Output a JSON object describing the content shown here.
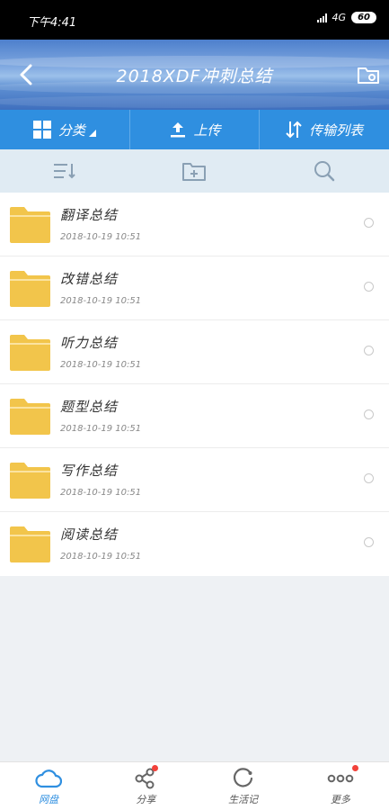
{
  "status_bar": {
    "time": "下午4:41",
    "network": "4G",
    "battery": "60"
  },
  "header": {
    "title": "2018XDF冲刺总结"
  },
  "action_bar": {
    "category_label": "分类",
    "upload_label": "上传",
    "transfer_label": "传输列表"
  },
  "files": [
    {
      "name": "翻译总结",
      "date": "2018-10-19  10:51"
    },
    {
      "name": "改错总结",
      "date": "2018-10-19  10:51"
    },
    {
      "name": "听力总结",
      "date": "2018-10-19  10:51"
    },
    {
      "name": "题型总结",
      "date": "2018-10-19  10:51"
    },
    {
      "name": "写作总结",
      "date": "2018-10-19  10:51"
    },
    {
      "name": "阅读总结",
      "date": "2018-10-19  10:51"
    }
  ],
  "bottom_nav": [
    {
      "label": "网盘",
      "icon": "cloud-icon",
      "active": true,
      "badge": false
    },
    {
      "label": "分享",
      "icon": "share-icon",
      "active": false,
      "badge": true
    },
    {
      "label": "生活记",
      "icon": "refresh-icon",
      "active": false,
      "badge": false
    },
    {
      "label": "更多",
      "icon": "more-icon",
      "active": false,
      "badge": true
    }
  ],
  "colors": {
    "accent": "#2f8fe0",
    "folder": "#f2c54b",
    "badge": "#f2413a"
  }
}
